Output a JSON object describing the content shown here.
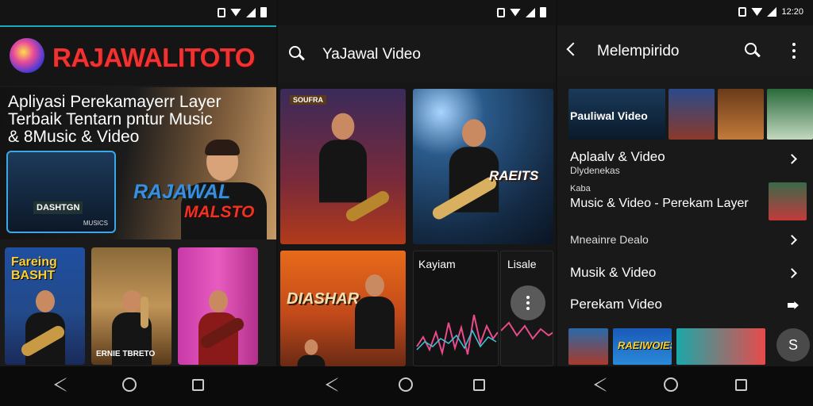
{
  "status": {
    "p3_time": "12:20"
  },
  "panel1": {
    "brand": "RAJAWALITOTO",
    "hero_title_l1": "Apliyasi Perekamayerr Layer",
    "hero_title_l2": "Terbaik Tentarn pntur Music",
    "hero_title_l3": "& 8Music & Video",
    "hero_thumb_label": "DASHTGN",
    "hero_thumb_tag": "MUSICS",
    "hero_logo_1": "RAJAWAL",
    "hero_logo_2": "MALSTO",
    "cards": [
      {
        "title": "Fareing BASHT",
        "badge": ""
      },
      {
        "title": "",
        "badge": "ERNIE TBRETO"
      },
      {
        "title": "",
        "badge": ""
      }
    ]
  },
  "panel2": {
    "title": "YaJawal Video",
    "t1_caption": "SOUFRA",
    "t2_caption": "RAEITS",
    "t3_caption": "DIASHAR",
    "t4_label": "Kayiam",
    "t5_label": "Lisale"
  },
  "panel3": {
    "title": "Melempirido",
    "strip_label": "Pauliwal Video",
    "rows": {
      "r1_main": "Aplaalv & Video",
      "r1_sub": "Dlydenekas",
      "r2_small": "Kaba",
      "r2_main": "Music & Video - Perekam Layer",
      "r3_main": "Mneainre Dealo",
      "r4_main": "Musik & Video",
      "r5_main": "Perekam Video"
    },
    "bottom_label": "RAEIWOIES",
    "fab_glyph": "S"
  },
  "colors": {
    "accent_teal": "#1aa9b8",
    "brand_red": "#ee3333"
  }
}
